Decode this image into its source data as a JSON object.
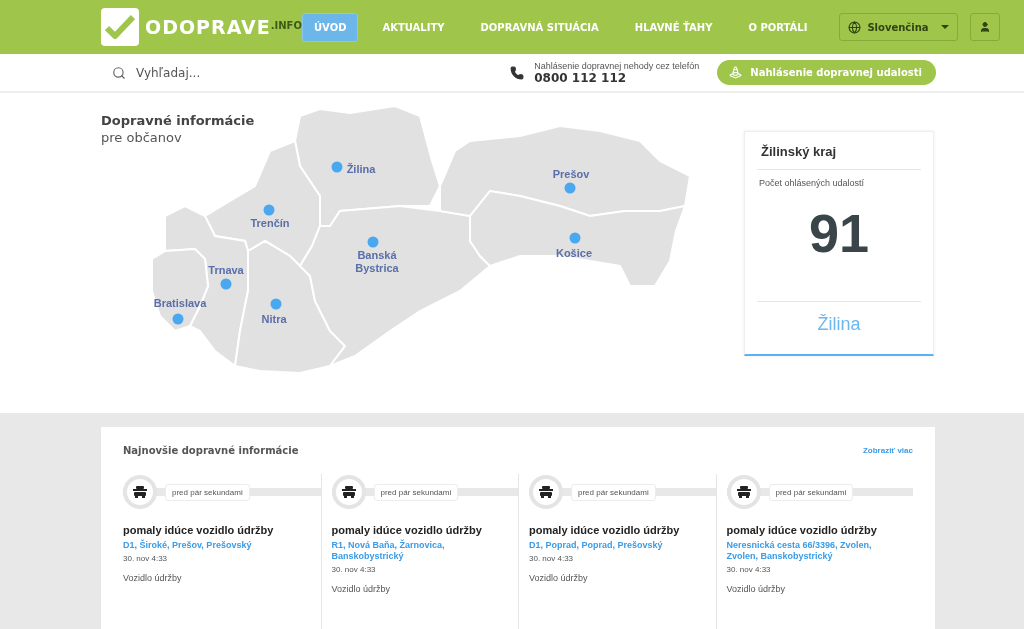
{
  "header": {
    "logo": {
      "name": "ODOPRAVE",
      "suffix": ".INFO"
    },
    "nav": [
      {
        "label": "ÚVOD",
        "selected": true
      },
      {
        "label": "AKTUALITY",
        "selected": false
      },
      {
        "label": "DOPRAVNÁ SITUÁCIA",
        "selected": false
      },
      {
        "label": "HLAVNÉ ŤAHY",
        "selected": false
      },
      {
        "label": "O PORTÁLI",
        "selected": false
      }
    ],
    "language": "Slovenčina"
  },
  "subbar": {
    "search": {
      "placeholder": "Vyhľadaj..."
    },
    "hotline": {
      "caption": "Nahlásenie dopravnej nehody cez telefón",
      "number": "0800 112 112"
    },
    "report_button": "Nahlásenie dopravnej udalosti"
  },
  "hero": {
    "title": "Dopravné informácie",
    "subtitle": "pre občanov",
    "regions": [
      {
        "name": "Žilina"
      },
      {
        "name": "Trenčín"
      },
      {
        "name": "Trnava"
      },
      {
        "name": "Bratislava"
      },
      {
        "name": "Nitra"
      },
      {
        "name": "Banská Bystrica"
      },
      {
        "name": "Prešov"
      },
      {
        "name": "Košice"
      }
    ]
  },
  "region_card": {
    "title": "Žilinský kraj",
    "caption": "Počet ohlásených udalostí",
    "count": "91",
    "city": "Žilina"
  },
  "news": {
    "title": "Najnovšie dopravné informácie",
    "more": "Zobraziť viac",
    "items": [
      {
        "time": "pred pár sekundami",
        "title": "pomaly idúce vozidlo údržby",
        "location": "D1, Široké, Prešov, Prešovský",
        "date": "30. nov 4:33",
        "type": "Vozidlo údržby"
      },
      {
        "time": "pred pár sekundami",
        "title": "pomaly idúce vozidlo údržby",
        "location": "R1, Nová Baňa, Žarnovica, Banskobystrický",
        "date": "30. nov 4:33",
        "type": "Vozidlo údržby"
      },
      {
        "time": "pred pár sekundami",
        "title": "pomaly idúce vozidlo údržby",
        "location": "D1, Poprad, Poprad, Prešovský",
        "date": "30. nov 4:33",
        "type": "Vozidlo údržby"
      },
      {
        "time": "pred pár sekundami",
        "title": "pomaly idúce vozidlo údržby",
        "location": "Neresnická cesta 66/3396, Zvolen, Zvolen, Banskobystrický",
        "date": "30. nov 4:33",
        "type": "Vozidlo údržby"
      }
    ]
  }
}
